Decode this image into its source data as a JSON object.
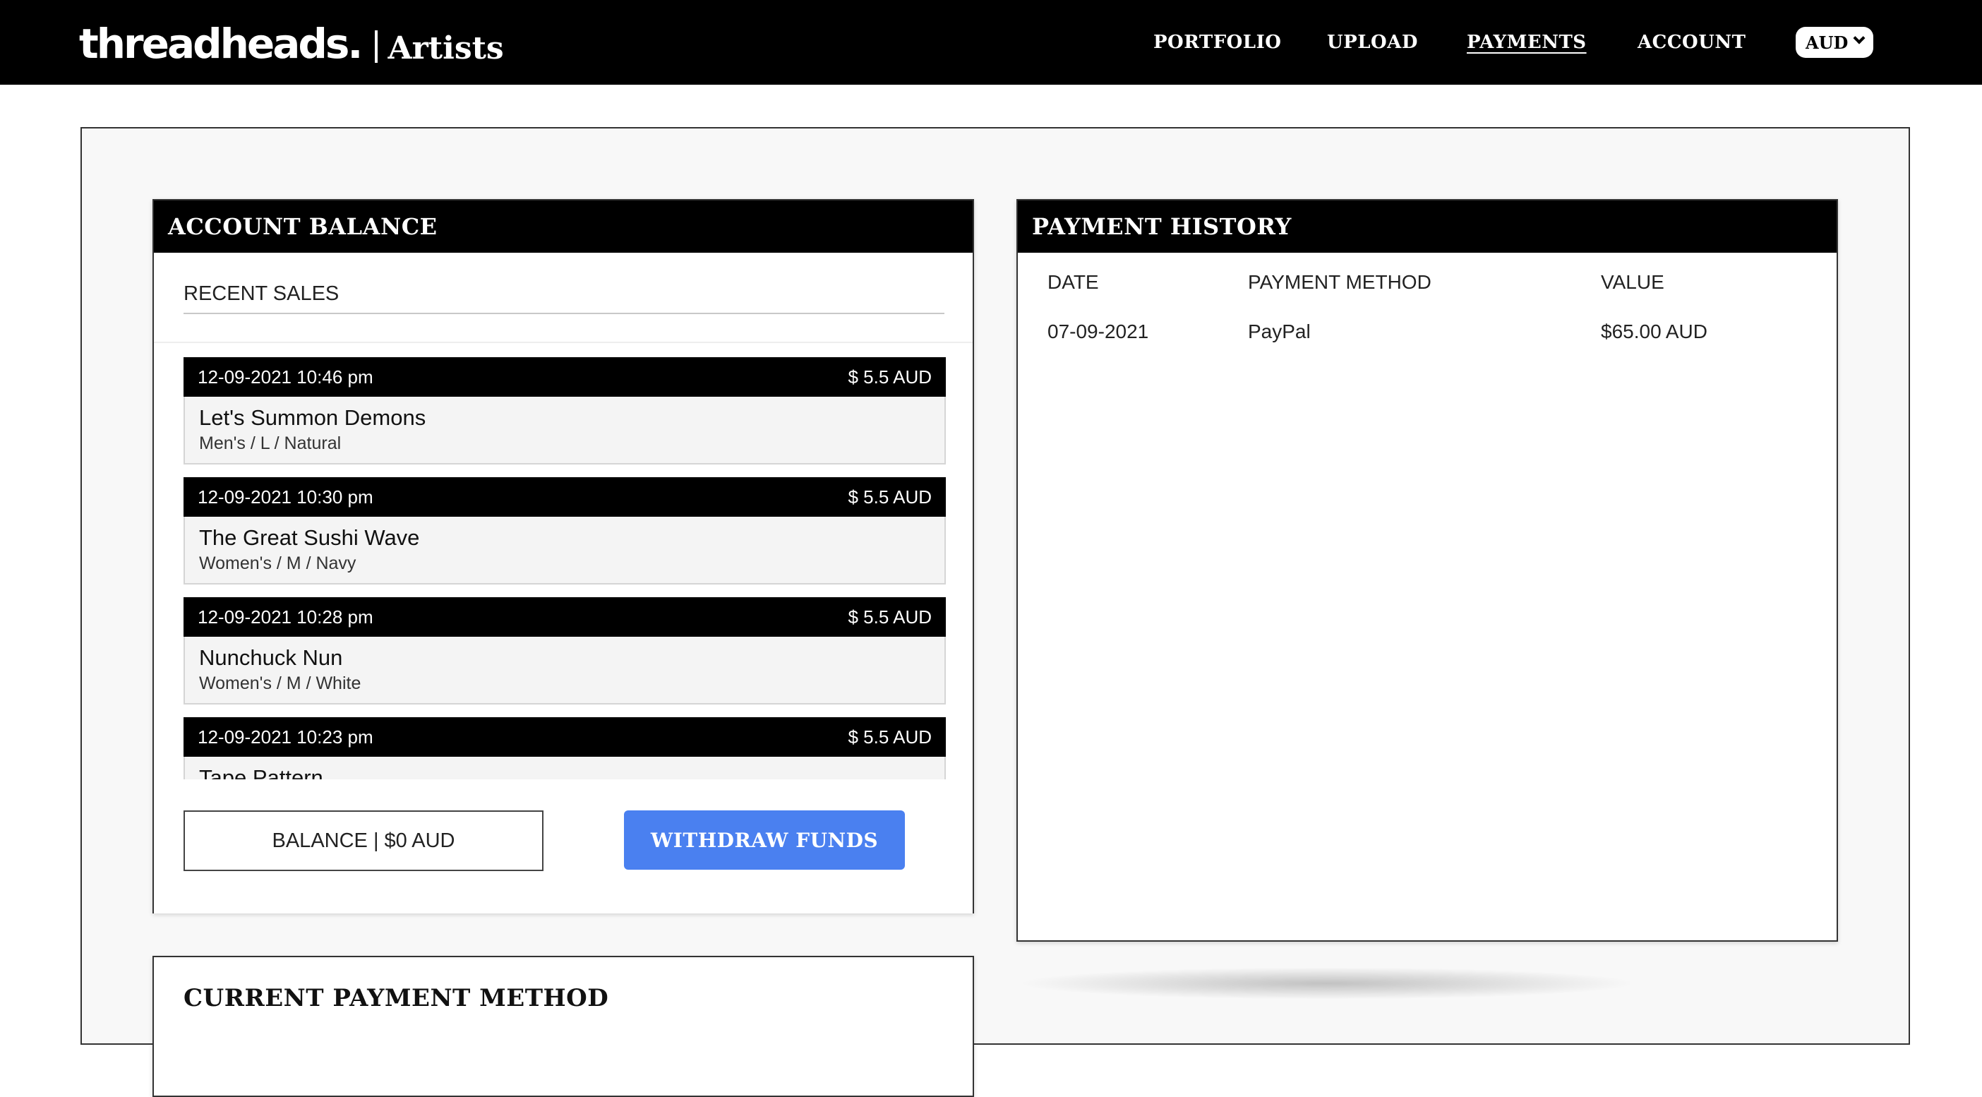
{
  "header": {
    "brand": "threadheads.",
    "brand_sub": "Artists",
    "nav": [
      {
        "label": "PORTFOLIO"
      },
      {
        "label": "UPLOAD"
      },
      {
        "label": "PAYMENTS",
        "active": true
      },
      {
        "label": "ACCOUNT"
      }
    ],
    "currency": "AUD"
  },
  "account_balance": {
    "title": "ACCOUNT BALANCE",
    "recent_sales_title": "RECENT SALES",
    "sales": [
      {
        "datetime": "12-09-2021 10:46 pm",
        "amount": "$ 5.5 AUD",
        "title": "Let's Summon Demons",
        "meta": "Men's / L / Natural"
      },
      {
        "datetime": "12-09-2021 10:30 pm",
        "amount": "$ 5.5 AUD",
        "title": "The Great Sushi Wave",
        "meta": "Women's / M / Navy"
      },
      {
        "datetime": "12-09-2021 10:28 pm",
        "amount": "$ 5.5 AUD",
        "title": "Nunchuck Nun",
        "meta": "Women's / M / White"
      },
      {
        "datetime": "12-09-2021 10:23 pm",
        "amount": "$ 5.5 AUD",
        "title": "Tape Pattern",
        "meta": ""
      }
    ],
    "balance_label": "BALANCE | $0 AUD",
    "withdraw_label": "WITHDRAW FUNDS"
  },
  "payment_history": {
    "title": "PAYMENT HISTORY",
    "columns": [
      "DATE",
      "PAYMENT METHOD",
      "VALUE"
    ],
    "rows": [
      [
        "07-09-2021",
        "PayPal",
        "$65.00 AUD"
      ]
    ]
  },
  "current_payment_method": {
    "title": "CURRENT PAYMENT METHOD"
  },
  "colors": {
    "accent": "#4a80f0",
    "header_bg": "#000000"
  }
}
